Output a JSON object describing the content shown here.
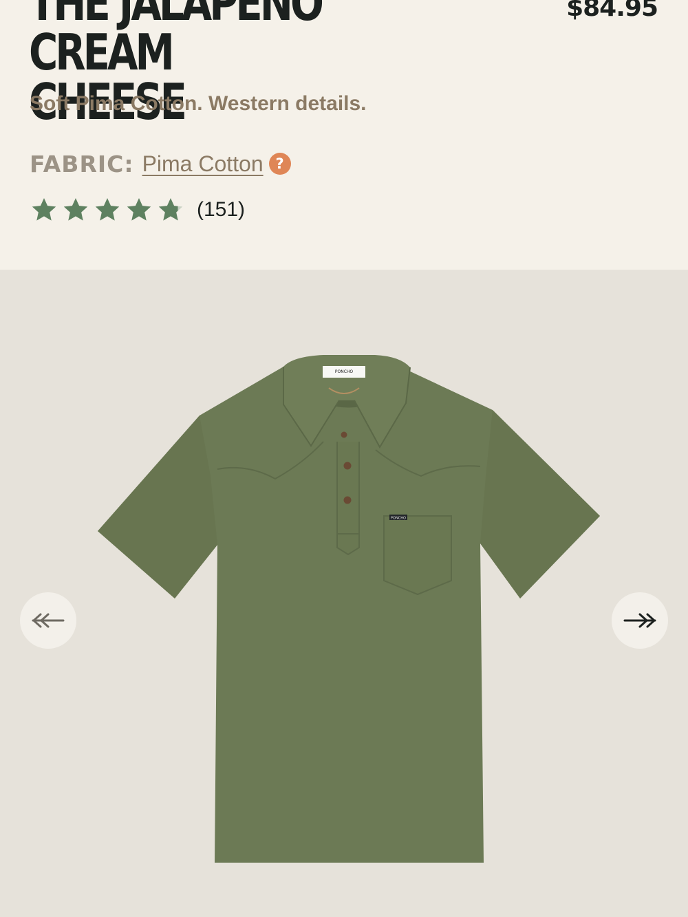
{
  "product": {
    "title_line1": "The Jalapeño Cream",
    "title_line2": "Cheese",
    "price": "$84.95",
    "tagline": "Soft Pima Cotton. Western details.",
    "fabric_label": "FABRIC:",
    "fabric_value": "Pima Cotton",
    "fabric_help_icon": "?",
    "rating": {
      "stars": 4.8,
      "max": 5,
      "review_count": "(151)"
    },
    "image": {
      "brand_tag": "PONCHO",
      "pocket_label": "PONCHO"
    }
  },
  "gallery": {
    "prev_icon": "arrow-left-icon",
    "next_icon": "arrow-right-icon"
  },
  "colors": {
    "background": "#f5f1e9",
    "gallery_background": "#e6e2da",
    "title": "#1c211f",
    "tagline": "#8b7a64",
    "fabric_label": "#9c9386",
    "help_icon": "#df8656",
    "star": "#5e8160",
    "shirt": "#6c7a55"
  }
}
